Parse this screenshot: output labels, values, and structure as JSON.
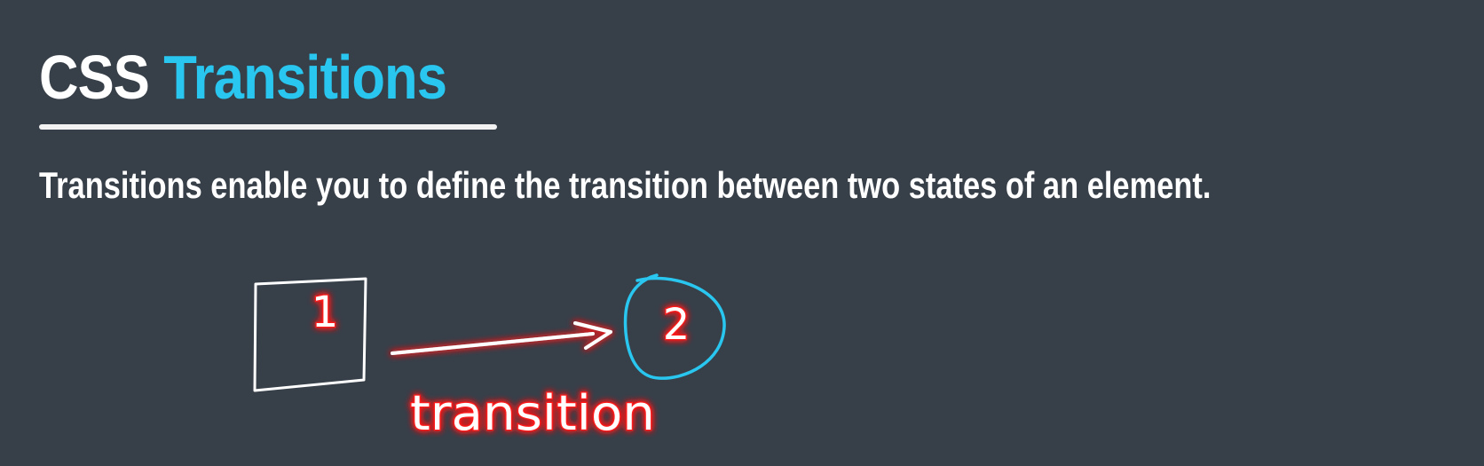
{
  "title": {
    "word1": "CSS",
    "word2": "Transitions"
  },
  "subtitle": "Transitions enable you to define the transition between two states of an element.",
  "diagram": {
    "state1_label": "1",
    "state2_label": "2",
    "arrow_label": "transition"
  },
  "colors": {
    "background": "#373f49",
    "accent": "#29c6ef",
    "annotation": "#ff1a1a",
    "text": "#ffffff"
  }
}
